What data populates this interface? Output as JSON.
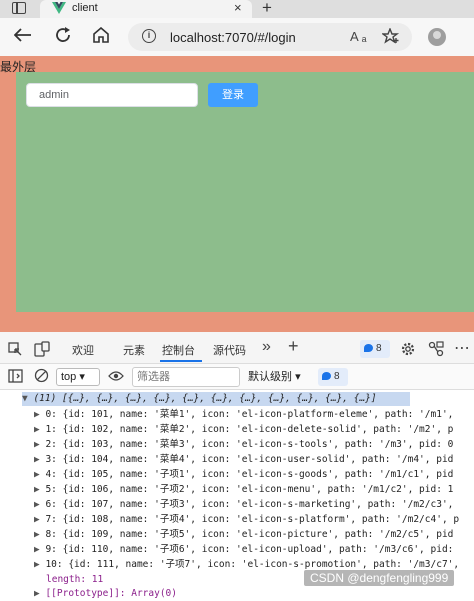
{
  "browser": {
    "tab_title": "client",
    "tab_close": "×",
    "newtab_label": "+",
    "url": "localhost:7070/#/login",
    "aa_label": "A ₐ"
  },
  "page": {
    "outer_label": "最外层",
    "username_value": "admin",
    "login_label": "登录",
    "colors": {
      "outer": "#e8957a",
      "inner": "#8dbd8c",
      "button": "#409eff"
    }
  },
  "devtools": {
    "tabs": [
      "欢迎",
      "元素",
      "控制台",
      "源代码"
    ],
    "active_tab": "控制台",
    "more_label": "»",
    "add_label": "+",
    "issues_count": "8",
    "context": "top",
    "filter_placeholder": "筛选器",
    "level_label": "默认级别",
    "issues_count2": "8"
  },
  "console": {
    "array_header": "(11) [{…}, {…}, {…}, {…}, {…}, {…}, {…}, {…}, {…}, {…}, {…}]",
    "rows": [
      "0: {id: 101, name: '菜单1', icon: 'el-icon-platform-eleme', path: '/m1',",
      "1: {id: 102, name: '菜单2', icon: 'el-icon-delete-solid', path: '/m2', p",
      "2: {id: 103, name: '菜单3', icon: 'el-icon-s-tools', path: '/m3', pid: 0",
      "3: {id: 104, name: '菜单4', icon: 'el-icon-user-solid', path: '/m4', pid",
      "4: {id: 105, name: '子项1', icon: 'el-icon-s-goods', path: '/m1/c1', pid",
      "5: {id: 106, name: '子项2', icon: 'el-icon-menu', path: '/m1/c2', pid: 1",
      "6: {id: 107, name: '子项3', icon: 'el-icon-s-marketing', path: '/m2/c3',",
      "7: {id: 108, name: '子项4', icon: 'el-icon-s-platform', path: '/m2/c4', p",
      "8: {id: 109, name: '子项5', icon: 'el-icon-picture', path: '/m2/c5', pid",
      "9: {id: 110, name: '子项6', icon: 'el-icon-upload', path: '/m3/c6', pid:",
      "10: {id: 111, name: '子项7', icon: 'el-icon-s-promotion', path: '/m3/c7',"
    ],
    "length_line": "length: 11",
    "prototype_line": "[[Prototype]]: Array(0)"
  },
  "watermark": "CSDN @dengfengling999"
}
